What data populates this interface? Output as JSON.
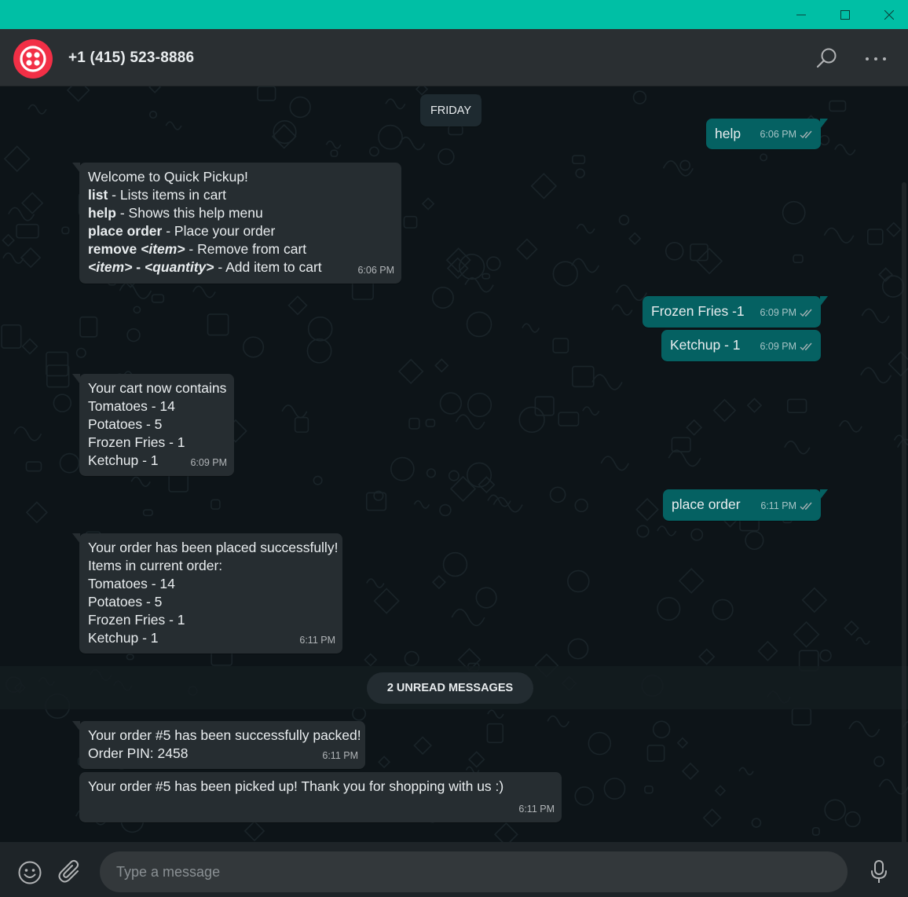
{
  "window": {
    "minimize_icon": "minimize-icon",
    "maximize_icon": "maximize-icon",
    "close_icon": "close-icon"
  },
  "header": {
    "contact_name": "+1 (415) 523-8886",
    "avatar_icon": "twilio-logo-icon",
    "search_icon": "search-icon",
    "menu_icon": "more-horizontal-icon"
  },
  "colors": {
    "title_bar": "#00bfa5",
    "outgoing_bubble": "#056162",
    "incoming_bubble": "#262d31",
    "avatar": "#f22f46"
  },
  "chat": {
    "date_divider": "FRIDAY",
    "unread_divider": "2 UNREAD MESSAGES",
    "messages": [
      {
        "direction": "out",
        "text": "help",
        "time": "6:06 PM",
        "status": "read"
      },
      {
        "direction": "in",
        "time": "6:06 PM",
        "lines": [
          {
            "plain": "Welcome to Quick Pickup!"
          },
          {
            "bold": "list",
            "rest": " - Lists items in cart"
          },
          {
            "bold": "help",
            "rest": " - Shows this help menu"
          },
          {
            "bold": "place order",
            "rest": " - Place your order"
          },
          {
            "bold": "remove ",
            "bold_italic": "<item>",
            "rest": " - Remove from cart"
          },
          {
            "bold_italic": "<item>",
            "bold": " - ",
            "bold_italic2": "<quantity>",
            "rest": " - Add item to cart"
          }
        ]
      },
      {
        "direction": "out",
        "text": "Frozen Fries -1",
        "time": "6:09 PM",
        "status": "read"
      },
      {
        "direction": "out",
        "text": "Ketchup - 1",
        "time": "6:09 PM",
        "status": "read"
      },
      {
        "direction": "in",
        "time": "6:09 PM",
        "lines": [
          "Your cart now contains",
          "Tomatoes - 14",
          "Potatoes - 5",
          "Frozen Fries - 1",
          "Ketchup - 1"
        ]
      },
      {
        "direction": "out",
        "text": "place order",
        "time": "6:11 PM",
        "status": "read"
      },
      {
        "direction": "in",
        "time": "6:11 PM",
        "lines": [
          "Your order has been placed successfully!",
          "Items in current order:",
          "Tomatoes - 14",
          "Potatoes - 5",
          "Frozen Fries - 1",
          "Ketchup - 1"
        ]
      },
      {
        "direction": "in",
        "time": "6:11 PM",
        "lines": [
          "Your order #5 has been successfully packed!",
          "Order PIN: 2458"
        ]
      },
      {
        "direction": "in",
        "time": "6:11 PM",
        "lines": [
          "Your order #5 has been picked up! Thank you for shopping with us :)"
        ]
      }
    ]
  },
  "footer": {
    "emoji_icon": "emoji-icon",
    "attach_icon": "paperclip-icon",
    "input_placeholder": "Type a message",
    "input_value": "",
    "mic_icon": "microphone-icon"
  }
}
